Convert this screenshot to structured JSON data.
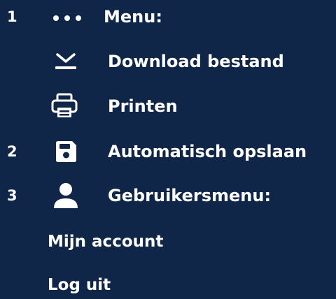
{
  "legend": {
    "items": [
      {
        "number": "1",
        "icon": "more-dots-icon",
        "label": "Menu:"
      },
      {
        "number": "",
        "icon": "download-icon",
        "label": "Download bestand"
      },
      {
        "number": "",
        "icon": "printer-icon",
        "label": "Printen"
      },
      {
        "number": "2",
        "icon": "save-icon",
        "label": "Automatisch opslaan"
      },
      {
        "number": "3",
        "icon": "user-icon",
        "label": "Gebruikersmenu:"
      }
    ],
    "user_menu": [
      {
        "label": "Mijn account"
      },
      {
        "label": "Log uit"
      }
    ]
  },
  "colors": {
    "background": "#0f2649",
    "foreground": "#ffffff"
  }
}
